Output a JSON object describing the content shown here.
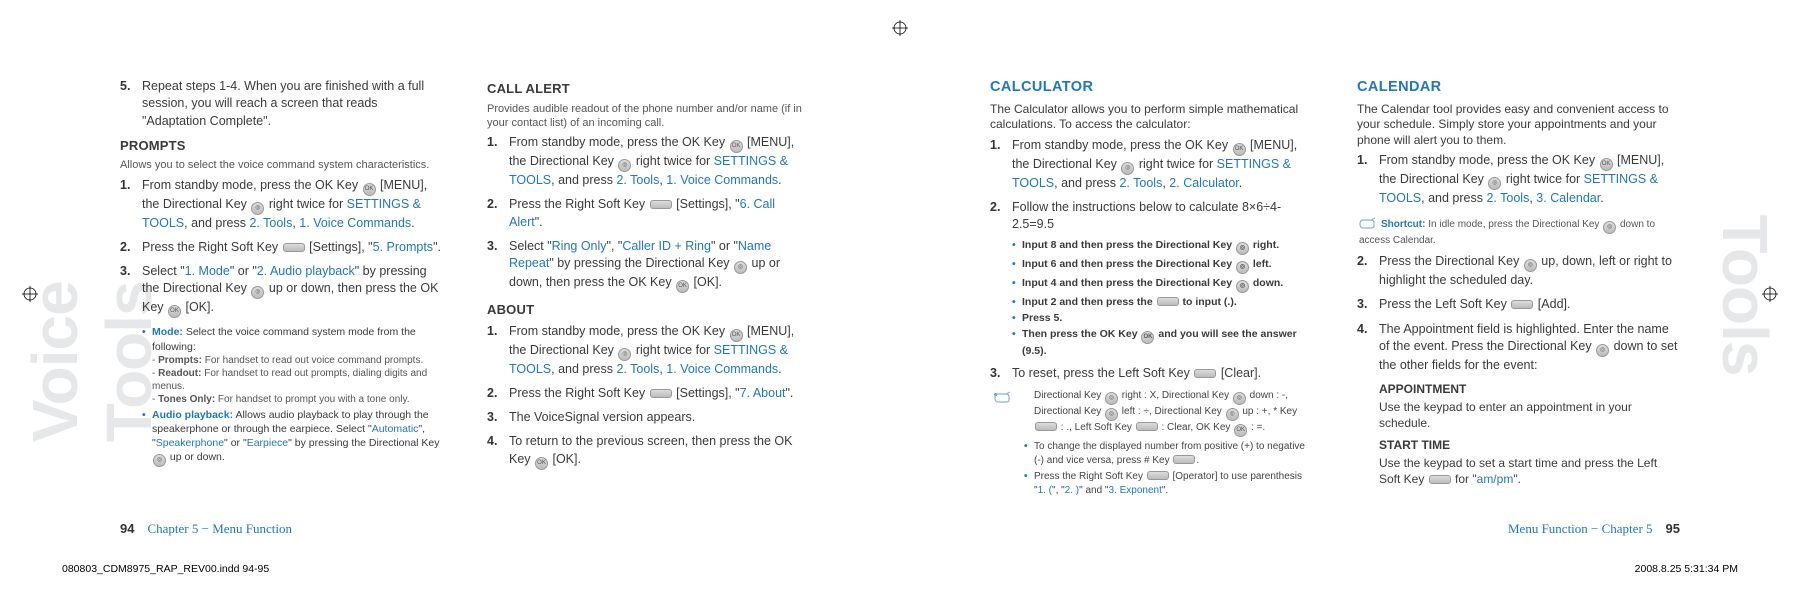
{
  "leftGhost": "Voice Tools",
  "rightGhost": "Tools",
  "leftPage": {
    "col1": {
      "step5": "Repeat steps 1-4. When you are finished with a full session, you will reach a screen that reads \"Adaptation Complete\".",
      "promptsHead": "PROMPTS",
      "promptsDesc": "Allows you to select the voice command system characteristics.",
      "p1a": "From standby mode, press the OK Key ",
      "p1b": " [MENU], the Directional Key ",
      "p1c": " right twice for ",
      "p1link1": "SETTINGS & TOOLS",
      "p1d": ", and press ",
      "p1link2": "2. Tools",
      "p1e": ", ",
      "p1link3": "1. Voice Commands",
      "p1f": ".",
      "p2a": "Press the Right Soft Key ",
      "p2b": " [Settings], \"",
      "p2link": "5. Prompts",
      "p2c": "\".",
      "p3a": "Select \"",
      "p3l1": "1. Mode",
      "p3b": "\" or \"",
      "p3l2": "2. Audio playback",
      "p3c": "\" by pressing the Directional Key ",
      "p3d": " up or down, then press the OK Key ",
      "p3e": " [OK].",
      "modeLabel": "Mode:",
      "modeText": " Select the voice command system mode from the following:",
      "modeA": "Prompts:",
      "modeAText": " For handset to read out voice command prompts.",
      "modeB": "Readout:",
      "modeBText": " For handset to read out prompts, dialing digits and menus.",
      "modeC": "Tones Only:",
      "modeCText": " For handset to prompt you with a tone only.",
      "audioLabel": "Audio playback:",
      "audioText": " Allows audio playback to play through the speakerphone or through the earpiece. Select \"",
      "audioL1": "Automatic",
      "audioMid1": "\", \"",
      "audioL2": "Speakerphone",
      "audioMid2": "\" or \"",
      "audioL3": "Earpiece",
      "audioEnd": "\" by pressing the Directional Key ",
      "audioEnd2": " up or down."
    },
    "col2": {
      "callAlertHead": "CALL ALERT",
      "callAlertDesc": "Provides audible readout of the phone number and/or name (if in your contact list) of an incoming call.",
      "c1a": "From standby mode, press the OK Key ",
      "c1b": " [MENU], the Directional Key ",
      "c1c": " right twice for ",
      "c1l1": "SETTINGS & TOOLS",
      "c1d": ", and press ",
      "c1l2": "2. Tools",
      "c1e": ", ",
      "c1l3": "1. Voice Commands",
      "c1f": ".",
      "c2a": "Press the Right Soft Key ",
      "c2b": " [Settings], \"",
      "c2l": "6. Call Alert",
      "c2c": "\".",
      "c3a": "Select \"",
      "c3l1": "Ring Only",
      "c3b": "\", \"",
      "c3l2": "Caller ID + Ring",
      "c3c": "\" or \"",
      "c3l3": "Name Repeat",
      "c3d": "\" by pressing the Directional Key ",
      "c3e": " up or down, then press the OK Key ",
      "c3f": " [OK].",
      "aboutHead": "ABOUT",
      "a1a": "From standby mode, press the OK Key ",
      "a1b": " [MENU], the Directional Key ",
      "a1c": " right twice for ",
      "a1l1": "SETTINGS & TOOLS",
      "a1d": ", and press ",
      "a1l2": "2. Tools",
      "a1e": ", ",
      "a1l3": "1. Voice Commands",
      "a1f": ".",
      "a2a": "Press the Right Soft Key ",
      "a2b": " [Settings], \"",
      "a2l": "7. About",
      "a2c": "\".",
      "a3": "The VoiceSignal version appears.",
      "a4a": "To return to the previous screen, then press the OK Key ",
      "a4b": " [OK]."
    }
  },
  "rightPage": {
    "col1": {
      "calcHead": "CALCULATOR",
      "calcDesc": "The Calculator allows you to perform simple mathematical calculations. To access the calculator:",
      "c1a": "From standby mode, press the OK Key ",
      "c1b": " [MENU], the Directional Key ",
      "c1c": " right twice for ",
      "c1l1": "SETTINGS & TOOLS",
      "c1d": ", and press ",
      "c1l2": "2. Tools",
      "c1e": ", ",
      "c1l3": "2. Calculator",
      "c1f": ".",
      "c2": "Follow the instructions below to calculate 8×6÷4-2.5=9.5",
      "b1a": "Input 8 and then press the Directional Key ",
      "b1b": " right.",
      "b2a": "Input 6 and then press the Directional Key ",
      "b2b": " left.",
      "b3a": "Input 4 and then press the Directional Key ",
      "b3b": " down.",
      "b4a": "Input 2 and then press the ",
      "b4b": " to input (.).",
      "b5": "Press 5.",
      "b6a": "Then press the OK Key ",
      "b6b": " and you will see the answer (9.5).",
      "c3a": "To reset, press the Left Soft Key ",
      "c3b": " [Clear].",
      "t1a": "Directional Key ",
      "t1b": " right : X, Directional Key ",
      "t1c": " down : -, Directional Key ",
      "t1d": " left : ÷, Directional Key ",
      "t1e": " up : +, * Key ",
      "t1f": " : ., Left Soft Key ",
      "t1g": " : Clear, OK Key ",
      "t1h": " : =.",
      "t2": "To change the displayed number from positive (+) to negative (-) and vice versa, press # Key ",
      "t2b": ".",
      "t3a": "Press the Right Soft Key ",
      "t3b": " [Operator] to use parenthesis \"",
      "t3l1": "1. (",
      "t3c": "\", \"",
      "t3l2": "2. )",
      "t3d": "\" and \"",
      "t3l3": "3. Exponent",
      "t3e": "\"."
    },
    "col2": {
      "calHead": "CALENDAR",
      "calDesc": "The Calendar tool provides easy and convenient access to your schedule. Simply store your appointments and your phone will alert you to them.",
      "s1a": "From standby mode, press the OK Key ",
      "s1b": " [MENU], the Directional Key ",
      "s1c": " right twice for ",
      "s1l1": "SETTINGS & TOOLS",
      "s1d": ", and press ",
      "s1l2": "2. Tools",
      "s1e": ", ",
      "s1l3": "3. Calendar",
      "s1f": ".",
      "shortcutLabel": "Shortcut:",
      "shortcutA": " In idle mode, press the Directional Key ",
      "shortcutB": " down to access Calendar.",
      "s2a": "Press the Directional Key ",
      "s2b": " up, down, left or right to highlight the scheduled day.",
      "s3a": "Press the Left Soft Key ",
      "s3b": " [Add].",
      "s4a": "The Appointment field is highlighted. Enter the name of the event. Press the Directional Key ",
      "s4b": " down to set the other fields for the event:",
      "apptHead": "APPOINTMENT",
      "apptBody": "Use the keypad to enter an appointment in your schedule.",
      "startHead": "START TIME",
      "startA": "Use the keypad to set a start time and press the Left Soft Key ",
      "startB": " for \"",
      "startL": "am/pm",
      "startC": "\"."
    }
  },
  "footer": {
    "leftNum": "94",
    "leftText": "Chapter 5 − Menu Function",
    "rightText": "Menu Function − Chapter 5",
    "rightNum": "95",
    "inddLeft": "080803_CDM8975_RAP_REV00.indd   94-95",
    "inddRight": "2008.8.25   5:31:34 PM"
  }
}
